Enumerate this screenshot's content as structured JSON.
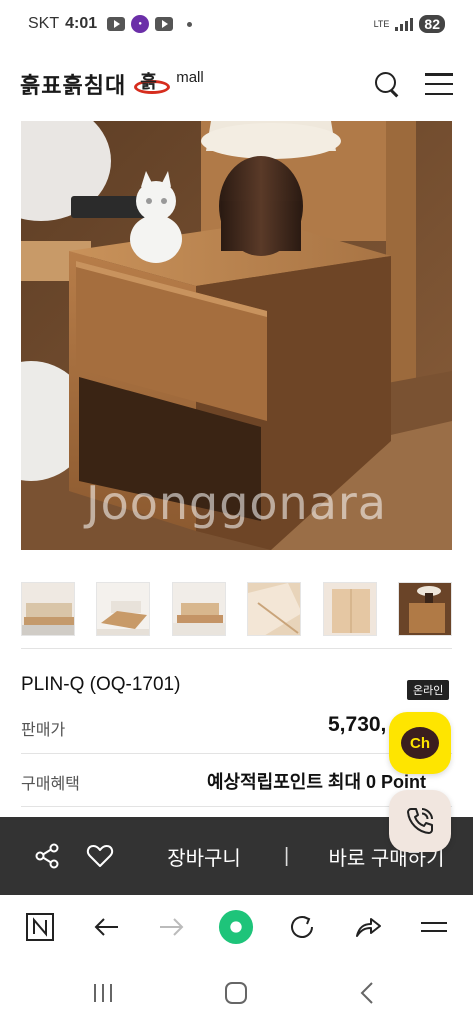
{
  "status_bar": {
    "carrier": "SKT",
    "time": "4:01",
    "network": "LTE",
    "battery": "82"
  },
  "header": {
    "logo_text": "흙표흙침대",
    "logo_glyph": "흙",
    "logo_suffix": "mall"
  },
  "hero": {
    "watermark": "Joonggonara"
  },
  "thumbnails": [
    {
      "icon": "bedroom-thumb"
    },
    {
      "icon": "bed-thumb"
    },
    {
      "icon": "bed-frame-thumb"
    },
    {
      "icon": "wood-detail-thumb"
    },
    {
      "icon": "cabinet-thumb"
    },
    {
      "icon": "nightstand-thumb"
    }
  ],
  "product": {
    "name": "PLIN-Q (OQ-1701)",
    "badge": "온라인",
    "price_label": "판매가",
    "price": "5,730,",
    "benefit_label": "구매혜택",
    "benefit_value": "예상적립포인트 최대 0 Point"
  },
  "floating": {
    "chat_label": "Ch"
  },
  "action_bar": {
    "cart_label": "장바구니",
    "separator": "|",
    "buy_label": "바로 구매하기"
  },
  "colors": {
    "action_bar_bg": "#333333",
    "kakao_yellow": "#fee500",
    "logo_red": "#d62d1e",
    "whale_green": "#1ec47a"
  }
}
